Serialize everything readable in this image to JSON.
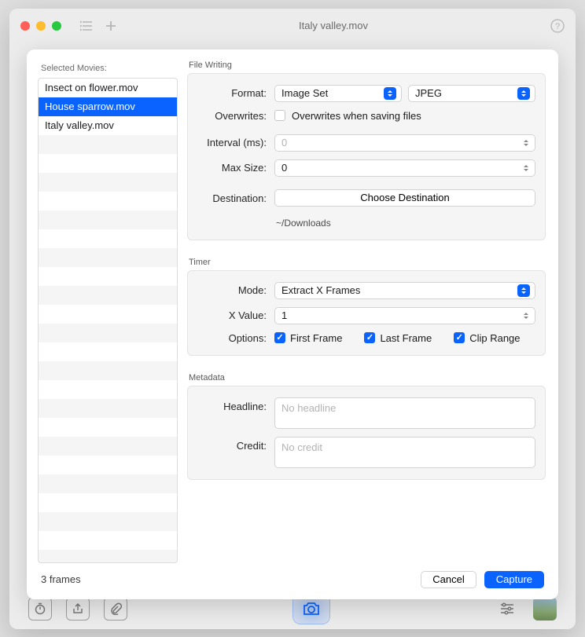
{
  "window": {
    "title": "Italy valley.mov"
  },
  "sidebar": {
    "header": "Selected Movies:",
    "movies": [
      {
        "name": "Insect on flower.mov",
        "selected": false
      },
      {
        "name": "House sparrow.mov",
        "selected": true
      },
      {
        "name": "Italy valley.mov",
        "selected": false
      }
    ]
  },
  "fileWriting": {
    "title": "File Writing",
    "formatLabel": "Format:",
    "formatValue": "Image Set",
    "formatTypeValue": "JPEG",
    "overwritesLabel": "Overwrites:",
    "overwritesText": "Overwrites when saving files",
    "overwritesChecked": false,
    "intervalLabel": "Interval (ms):",
    "intervalPlaceholder": "0",
    "maxSizeLabel": "Max Size:",
    "maxSizeValue": "0",
    "destinationLabel": "Destination:",
    "destinationButton": "Choose Destination",
    "destinationPath": "~/Downloads"
  },
  "timer": {
    "title": "Timer",
    "modeLabel": "Mode:",
    "modeValue": "Extract X Frames",
    "xLabel": "X Value:",
    "xValue": "1",
    "optionsLabel": "Options:",
    "options": {
      "firstFrame": {
        "label": "First Frame",
        "checked": true
      },
      "lastFrame": {
        "label": "Last Frame",
        "checked": true
      },
      "clipRange": {
        "label": "Clip Range",
        "checked": true
      }
    }
  },
  "metadata": {
    "title": "Metadata",
    "headlineLabel": "Headline:",
    "headlinePlaceholder": "No headline",
    "creditLabel": "Credit:",
    "creditPlaceholder": "No credit"
  },
  "footer": {
    "status": "3 frames",
    "cancel": "Cancel",
    "capture": "Capture"
  }
}
